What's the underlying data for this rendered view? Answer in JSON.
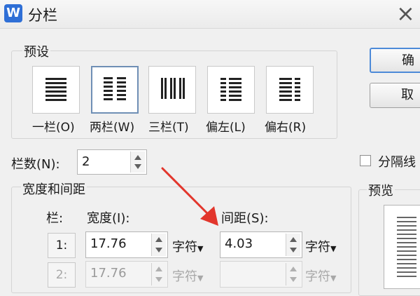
{
  "window": {
    "app_icon_letter": "W",
    "title": "分栏",
    "close_glyph": "×"
  },
  "presets": {
    "group_title": "预设",
    "items": [
      {
        "label": "一栏(O)",
        "selected": false
      },
      {
        "label": "两栏(W)",
        "selected": true
      },
      {
        "label": "三栏(T)",
        "selected": false
      },
      {
        "label": "偏左(L)",
        "selected": false
      },
      {
        "label": "偏右(R)",
        "selected": false
      }
    ]
  },
  "columns": {
    "label": "栏数(N):",
    "value": "2"
  },
  "width_spacing": {
    "group_title": "宽度和间距",
    "col_header": "栏:",
    "width_header": "宽度(I):",
    "spacing_header": "间距(S):",
    "rows": [
      {
        "index": "1:",
        "width": "17.76",
        "width_unit": "字符",
        "spacing": "4.03",
        "spacing_unit": "字符",
        "enabled": true
      },
      {
        "index": "2:",
        "width": "17.76",
        "width_unit": "字符",
        "spacing": "",
        "spacing_unit": "字符",
        "enabled": false
      }
    ]
  },
  "side": {
    "ok_label": "确",
    "cancel_label": "取",
    "separator_label": "分隔线",
    "preview_title": "预览"
  },
  "annotation": {
    "arrow_color": "#e2362c"
  },
  "colors": {
    "accent": "#4d8ad8",
    "selected_border": "#6f8fb5"
  }
}
